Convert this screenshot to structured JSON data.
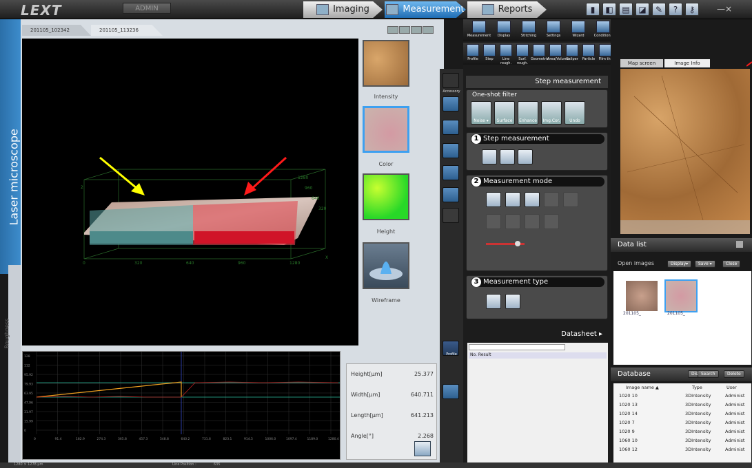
{
  "app": {
    "logo": "LEXT",
    "user": "ADMIN"
  },
  "nav": {
    "imaging": "Imaging",
    "measurement": "Measurement",
    "reports": "Reports"
  },
  "sidebar": {
    "title": "Laser microscope",
    "roughness": "Roughness"
  },
  "files": {
    "tab1": "201105_102342",
    "tab2": "201105_113236"
  },
  "views": {
    "intensity": "Intensity",
    "color": "Color",
    "height": "Height",
    "wireframe": "Wireframe"
  },
  "axis3d": {
    "x_ticks": [
      "0",
      "320",
      "640",
      "960",
      "1280"
    ],
    "z_tick": "2",
    "y_ticks": [
      "1280",
      "960",
      "640",
      "320"
    ]
  },
  "profile": {
    "y_ticks": [
      "128",
      "112",
      "95.92",
      "79.93",
      "63.95",
      "47.96",
      "31.97",
      "15.99",
      "0"
    ],
    "x_ticks": [
      "0",
      "91.4",
      "182.9",
      "274.3",
      "365.8",
      "457.3",
      "548.8",
      "640.2",
      "731.6",
      "823.1",
      "914.5",
      "1006.0",
      "1097.4",
      "1189.0",
      "1280.4"
    ]
  },
  "results": [
    {
      "label": "Height[µm]",
      "value": "25.377"
    },
    {
      "label": "Width[µm]",
      "value": "640.711"
    },
    {
      "label": "Length[µm]",
      "value": "641.213"
    },
    {
      "label": "Angle[°]",
      "value": "2.268"
    }
  ],
  "ribbon1": [
    "Measurement",
    "Display",
    "Stitching",
    "Settings",
    "Wizard",
    "Conditions"
  ],
  "ribbon2": [
    "Profile",
    "Step",
    "Line rough.",
    "Surf. rough.",
    "Geometric",
    "Area/Volume",
    "Caliper",
    "Particle",
    "Film th."
  ],
  "accessory": "Accessory",
  "step": {
    "title": "Step measurement",
    "filter_title": "One-shot filter",
    "filter_buttons": [
      "Noise ▾",
      "Surface",
      "Enhance",
      "Img.Cor.",
      "Undo"
    ],
    "sec1": "Step measurement",
    "sec2": "Measurement mode",
    "sec3": "Measurement type"
  },
  "datasheet": {
    "title": "Datasheet ▸",
    "col_no": "No.",
    "col_result": "Result"
  },
  "profile_btn": "Profile",
  "map": {
    "tab1": "Map screen",
    "tab2": "Image Info"
  },
  "datalist": {
    "title": "Data list",
    "open_images": "Open images",
    "display": "Display▾",
    "save": "Save ▾",
    "close": "Close",
    "img1": "201105_",
    "img2": "201105_"
  },
  "database": {
    "title": "Database",
    "display": "Display▾",
    "search": "Search",
    "delete": "Delete",
    "col_name": "Image name ▲",
    "col_type": "Type",
    "col_user": "User",
    "rows": [
      {
        "name": "1020 10",
        "type": "3DIntensity",
        "user": "Administ"
      },
      {
        "name": "1020 13",
        "type": "3DIntensity",
        "user": "Administ"
      },
      {
        "name": "1020 14",
        "type": "3DIntensity",
        "user": "Administ"
      },
      {
        "name": "1020 7",
        "type": "3DIntensity",
        "user": "Administ"
      },
      {
        "name": "1020 9",
        "type": "3DIntensity",
        "user": "Administ"
      },
      {
        "name": "1060 10",
        "type": "3DIntensity",
        "user": "Administ"
      },
      {
        "name": "1060 12",
        "type": "3DIntensity",
        "user": "Administ"
      }
    ]
  },
  "status": {
    "size": "1280 × 1278 µm",
    "line_position": "Line Position :",
    "line_value": "635"
  },
  "colors": {
    "accent": "#2f7fc4",
    "arrow_yellow": "#ffff00",
    "arrow_red": "#ff1a1a"
  }
}
